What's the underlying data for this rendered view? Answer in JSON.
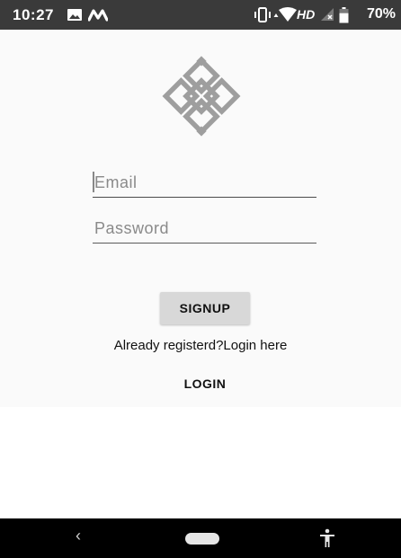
{
  "status_bar": {
    "time": "10:27",
    "network_label": "HD",
    "battery_percent": "70%",
    "battery_level": 0.7,
    "icons": [
      "image-icon",
      "m-app-icon",
      "vibrate-icon",
      "data-arrows-icon",
      "wifi-icon",
      "cell-signal-icon",
      "battery-icon"
    ]
  },
  "logo": {
    "icon": "knot-logo-icon"
  },
  "form": {
    "email": {
      "value": "",
      "placeholder": "Email"
    },
    "password": {
      "value": "",
      "placeholder": "Password"
    },
    "signup_label": "SIGNUP",
    "already_text": "Already registerd?Login here",
    "login_label": "LOGIN"
  },
  "nav_bar": {
    "back_glyph": "‹",
    "icons": [
      "back-icon",
      "home-pill-icon",
      "accessibility-icon"
    ]
  },
  "colors": {
    "status_bar": "#3a3a3a",
    "background": "#fafafa",
    "signup_button": "#d8d8d8",
    "nav_bar": "#000000",
    "logo": "#9e9e9e"
  }
}
